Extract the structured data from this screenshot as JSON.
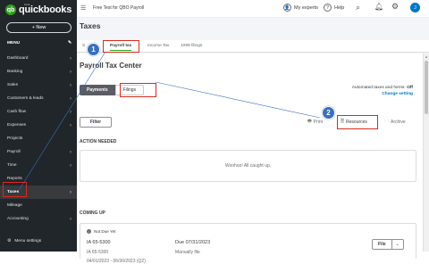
{
  "brand": {
    "small": "intuit",
    "name": "quickbooks",
    "mark": "qb"
  },
  "sidebar": {
    "new_label": "+  New",
    "menu_label": "MENU",
    "items": [
      {
        "label": "Dashboard",
        "chev": true
      },
      {
        "label": "Banking",
        "chev": true
      },
      {
        "label": "Sales",
        "chev": true
      },
      {
        "label": "Customers & leads",
        "chev": true
      },
      {
        "label": "Cash flow",
        "chev": true
      },
      {
        "label": "Expenses",
        "chev": true
      },
      {
        "label": "Projects",
        "chev": false
      },
      {
        "label": "Payroll",
        "chev": true
      },
      {
        "label": "Time",
        "chev": true
      },
      {
        "label": "Reports",
        "chev": false
      },
      {
        "label": "Taxes",
        "chev": true,
        "active": true
      },
      {
        "label": "Mileage",
        "chev": false
      },
      {
        "label": "Accounting",
        "chev": true
      }
    ],
    "settings_label": "Menu settings"
  },
  "topbar": {
    "company": "Free Test for QBO Payroll",
    "experts": "My experts",
    "help": "Help",
    "avatar": "J"
  },
  "page": {
    "title": "Taxes",
    "tabs": [
      {
        "label": "S",
        "active": false
      },
      {
        "label": "Payroll tax",
        "active": true
      },
      {
        "label": "Income Tax",
        "active": false
      },
      {
        "label": "1099 filings",
        "active": false
      }
    ],
    "center_title": "Payroll Tax Center",
    "seg": {
      "payments": "Payments",
      "filings": "Filings"
    },
    "auto_line": "Automated taxes and forms:",
    "auto_value": "Off",
    "auto_link": "Change setting",
    "filter": "Filter",
    "print": "Print",
    "resources": "Resources",
    "archive": "Archive",
    "action_needed": "ACTION NEEDED",
    "woohoo": "Woohoo! All caught up.",
    "coming_up": "COMING UP",
    "filing": {
      "status": "Not Due Yet",
      "form": "IA 65-5300",
      "form_id": "IA 65-5300",
      "period": "04/01/2023 - 06/30/2023 (Q2)",
      "due": "Due 07/31/2023",
      "method": "Manually file",
      "file_btn": "File"
    }
  },
  "callouts": {
    "one": "1",
    "two": "2"
  },
  "colors": {
    "sidebar": "#21262a",
    "accent_green": "#2ca01c",
    "link_blue": "#0077c5",
    "highlight_red": "#d52b1e",
    "callout_blue": "#3a6ebf"
  }
}
